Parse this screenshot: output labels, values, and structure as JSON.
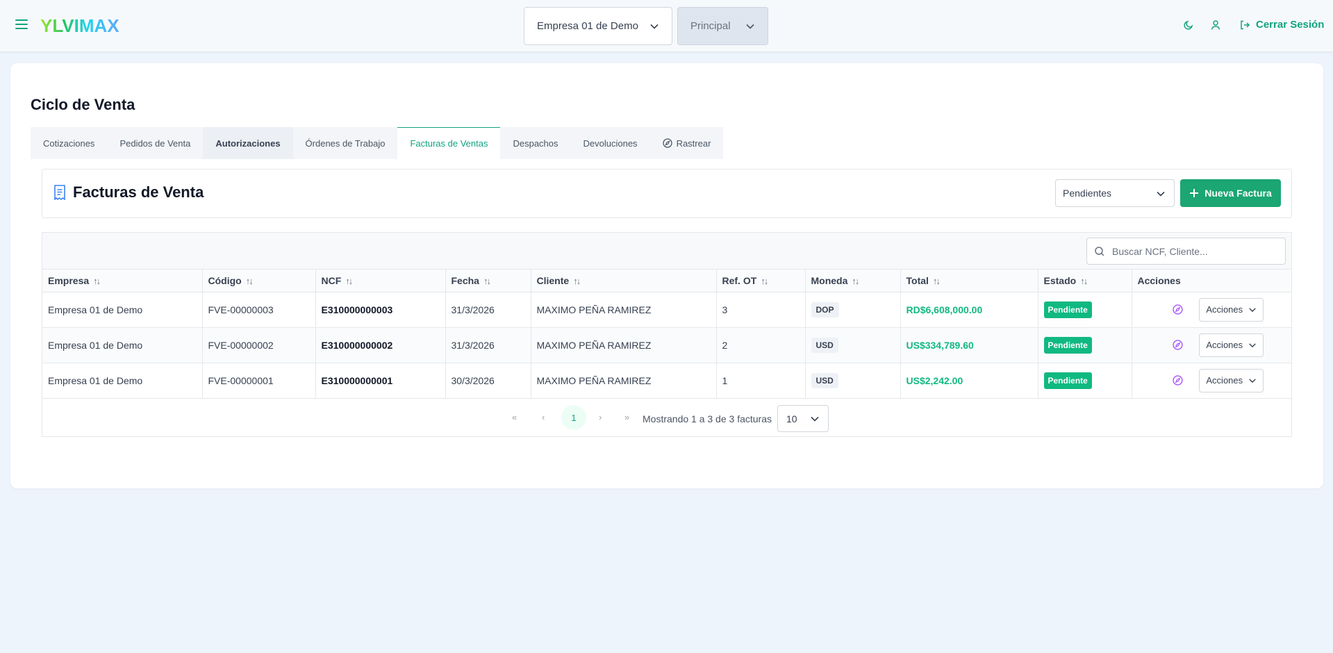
{
  "app": {
    "logo": "YLVIMAX"
  },
  "topbar": {
    "company": "Empresa 01 de Demo",
    "branch": "Principal",
    "logout_label": "Cerrar Sesión",
    "icons": [
      "menu-icon",
      "moon-icon",
      "user-icon",
      "logout-icon"
    ]
  },
  "page": {
    "title": "Ciclo de Venta"
  },
  "tabs": [
    {
      "label": "Cotizaciones"
    },
    {
      "label": "Pedidos de Venta"
    },
    {
      "label": "Autorizaciones"
    },
    {
      "label": "Órdenes de Trabajo"
    },
    {
      "label": "Facturas de Ventas",
      "active": true
    },
    {
      "label": "Despachos"
    },
    {
      "label": "Devoluciones"
    },
    {
      "label": "Rastrear",
      "icon": "compass-icon"
    }
  ],
  "section": {
    "title": "Facturas de Venta",
    "filter_value": "Pendientes",
    "new_button": "Nueva Factura"
  },
  "search": {
    "placeholder": "Buscar NCF, Cliente..."
  },
  "table": {
    "columns": [
      "Empresa",
      "Código",
      "NCF",
      "Fecha",
      "Cliente",
      "Ref. OT",
      "Moneda",
      "Total",
      "Estado",
      "Acciones"
    ],
    "rows": [
      {
        "empresa": "Empresa 01 de Demo",
        "codigo": "FVE-00000003",
        "ncf": "E310000000003",
        "fecha": "31/3/2026",
        "cliente": "MAXIMO PEÑA RAMIREZ",
        "ref_ot": "3",
        "moneda": "DOP",
        "total": "RD$6,608,000.00",
        "estado": "Pendiente",
        "acciones": "Acciones"
      },
      {
        "empresa": "Empresa 01 de Demo",
        "codigo": "FVE-00000002",
        "ncf": "E310000000002",
        "fecha": "31/3/2026",
        "cliente": "MAXIMO PEÑA RAMIREZ",
        "ref_ot": "2",
        "moneda": "USD",
        "total": "US$334,789.60",
        "estado": "Pendiente",
        "acciones": "Acciones"
      },
      {
        "empresa": "Empresa 01 de Demo",
        "codigo": "FVE-00000001",
        "ncf": "E310000000001",
        "fecha": "30/3/2026",
        "cliente": "MAXIMO PEÑA RAMIREZ",
        "ref_ot": "1",
        "moneda": "USD",
        "total": "US$2,242.00",
        "estado": "Pendiente",
        "acciones": "Acciones"
      }
    ]
  },
  "pagination": {
    "current_page": "1",
    "info": "Mostrando 1 a 3 de 3 facturas",
    "page_size": "10"
  },
  "colors": {
    "accent": "#10a37f",
    "success": "#10b981",
    "button": "#1ba673",
    "background": "#eef4fc"
  }
}
